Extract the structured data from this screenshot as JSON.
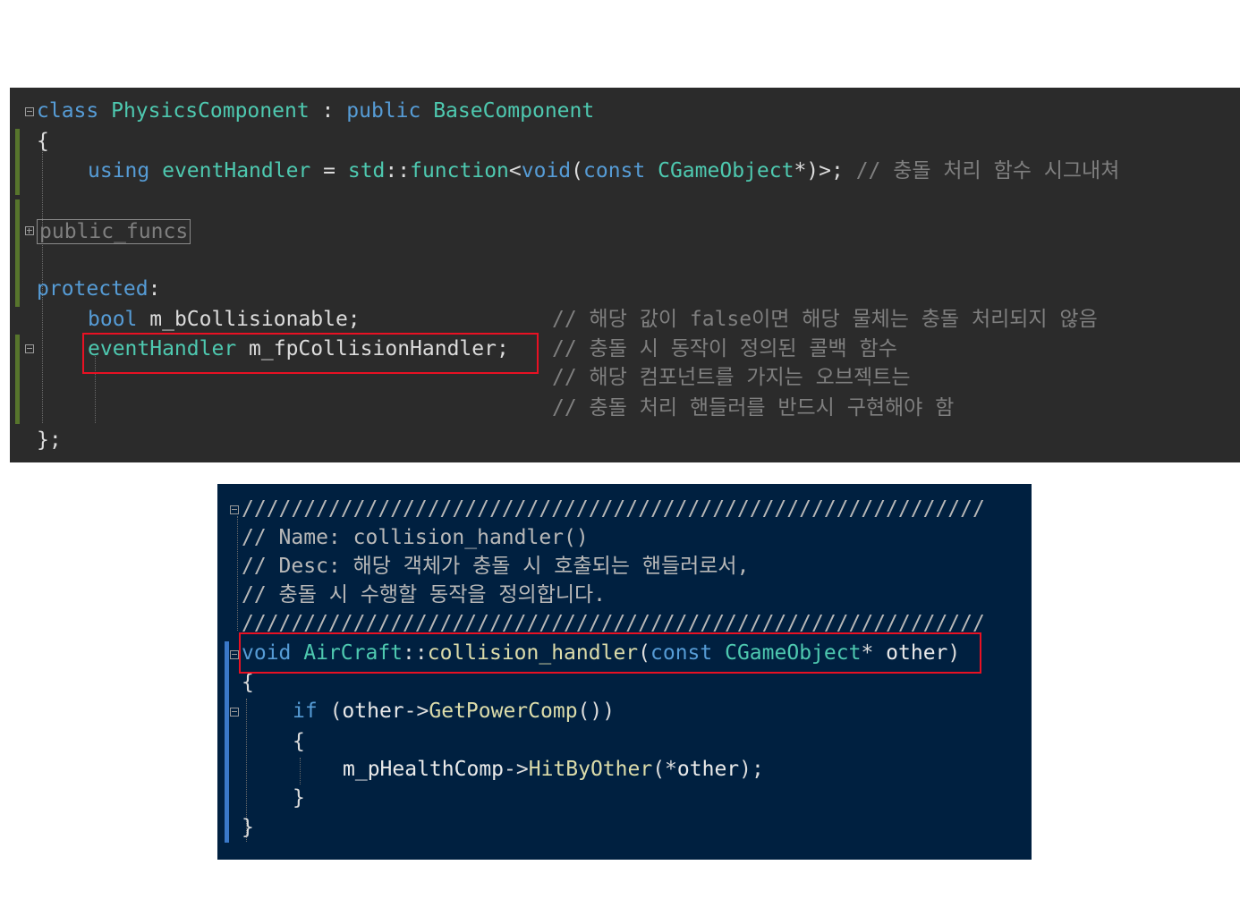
{
  "panel1": {
    "line_class": "class PhysicsComponent : public BaseComponent",
    "tokens": {
      "class_kw": "class",
      "class_name": "PhysicsComponent",
      "colon": ":",
      "public_kw": "public",
      "base_name": "BaseComponent",
      "open_brace": "{",
      "using_kw": "using",
      "alias_name": "eventHandler",
      "equals": "=",
      "std_ns": "std",
      "scope": "::",
      "function_tpl": "function",
      "lt": "<",
      "void_kw": "void",
      "paren_open": "(",
      "const_kw": "const",
      "cgo_type": "CGameObject",
      "ptr_close": "*)>;",
      "using_comment": "// 충돌 처리 함수 시그내쳐",
      "macro_collapsed": "public_funcs",
      "protected_kw": "protected",
      "protected_colon": ":",
      "bool_kw": "bool",
      "member1": "m_bCollisionable;",
      "comment1": "// 해당 값이 false이면 해당 물체는 충돌 처리되지 않음",
      "handler_type": "eventHandler",
      "member2": "m_fpCollisionHandler;",
      "comment2": "// 충돌 시 동작이 정의된 콜백 함수",
      "comment3": "// 해당 컴포넌트를 가지는 오브젝트는",
      "comment4": "// 충돌 처리 핸들러를 반드시 구현해야 함",
      "close_brace": "};"
    }
  },
  "panel2": {
    "slashes_top": "////////////////////////////////////////////////////////////",
    "comment_name": "// Name: collision_handler()",
    "comment_desc": "// Desc: 해당 객체가 충돌 시 호출되는 핸들러로서,",
    "comment_desc2": "// 충돌 시 수행할 동작을 정의합니다.",
    "slashes_bottom": "////////////////////////////////////////////////////////////",
    "tokens": {
      "void_kw": "void",
      "class_name": "AirCraft",
      "scope": "::",
      "fn_name": "collision_handler",
      "paren_open": "(",
      "const_kw": "const",
      "cgo_type": "CGameObject",
      "star": "*",
      "param": "other",
      "paren_close": ")",
      "open_brace": "{",
      "if_kw": "if",
      "if_open": "(",
      "other_var": "other",
      "arrow": "->",
      "get_fn": "GetPowerComp",
      "if_close": "())",
      "inner_open": "{",
      "member_var": "m_pHealthComp",
      "arrow2": "->",
      "hit_fn": "HitByOther",
      "call_args_open": "(*",
      "other_arg": "other",
      "call_args_close": ");",
      "inner_close": "}",
      "close_brace": "}"
    }
  },
  "colors": {
    "panel1_bg": "#2b2b2b",
    "panel2_bg": "#002040",
    "highlight_box": "#e81123",
    "change_bar_green": "#57752c",
    "change_bar_blue": "#3a78c8"
  }
}
